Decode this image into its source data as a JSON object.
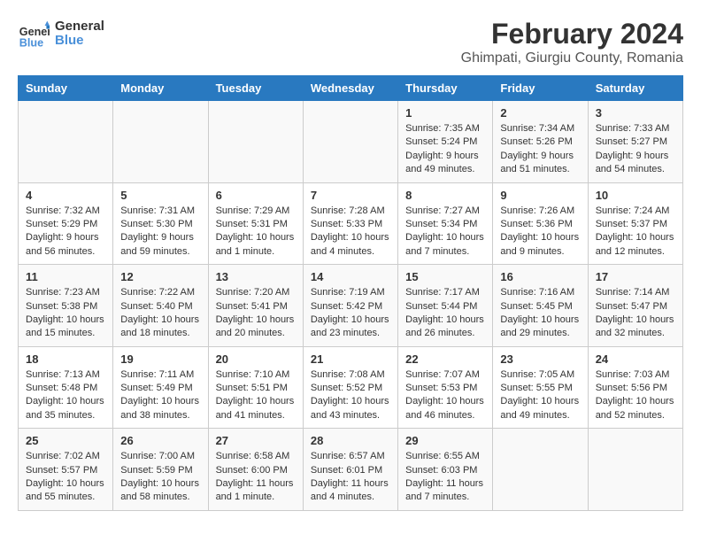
{
  "logo": {
    "line1": "General",
    "line2": "Blue"
  },
  "title": "February 2024",
  "subtitle": "Ghimpati, Giurgiu County, Romania",
  "days_of_week": [
    "Sunday",
    "Monday",
    "Tuesday",
    "Wednesday",
    "Thursday",
    "Friday",
    "Saturday"
  ],
  "weeks": [
    [
      {
        "day": "",
        "info": ""
      },
      {
        "day": "",
        "info": ""
      },
      {
        "day": "",
        "info": ""
      },
      {
        "day": "",
        "info": ""
      },
      {
        "day": "1",
        "info": "Sunrise: 7:35 AM\nSunset: 5:24 PM\nDaylight: 9 hours and 49 minutes."
      },
      {
        "day": "2",
        "info": "Sunrise: 7:34 AM\nSunset: 5:26 PM\nDaylight: 9 hours and 51 minutes."
      },
      {
        "day": "3",
        "info": "Sunrise: 7:33 AM\nSunset: 5:27 PM\nDaylight: 9 hours and 54 minutes."
      }
    ],
    [
      {
        "day": "4",
        "info": "Sunrise: 7:32 AM\nSunset: 5:29 PM\nDaylight: 9 hours and 56 minutes."
      },
      {
        "day": "5",
        "info": "Sunrise: 7:31 AM\nSunset: 5:30 PM\nDaylight: 9 hours and 59 minutes."
      },
      {
        "day": "6",
        "info": "Sunrise: 7:29 AM\nSunset: 5:31 PM\nDaylight: 10 hours and 1 minute."
      },
      {
        "day": "7",
        "info": "Sunrise: 7:28 AM\nSunset: 5:33 PM\nDaylight: 10 hours and 4 minutes."
      },
      {
        "day": "8",
        "info": "Sunrise: 7:27 AM\nSunset: 5:34 PM\nDaylight: 10 hours and 7 minutes."
      },
      {
        "day": "9",
        "info": "Sunrise: 7:26 AM\nSunset: 5:36 PM\nDaylight: 10 hours and 9 minutes."
      },
      {
        "day": "10",
        "info": "Sunrise: 7:24 AM\nSunset: 5:37 PM\nDaylight: 10 hours and 12 minutes."
      }
    ],
    [
      {
        "day": "11",
        "info": "Sunrise: 7:23 AM\nSunset: 5:38 PM\nDaylight: 10 hours and 15 minutes."
      },
      {
        "day": "12",
        "info": "Sunrise: 7:22 AM\nSunset: 5:40 PM\nDaylight: 10 hours and 18 minutes."
      },
      {
        "day": "13",
        "info": "Sunrise: 7:20 AM\nSunset: 5:41 PM\nDaylight: 10 hours and 20 minutes."
      },
      {
        "day": "14",
        "info": "Sunrise: 7:19 AM\nSunset: 5:42 PM\nDaylight: 10 hours and 23 minutes."
      },
      {
        "day": "15",
        "info": "Sunrise: 7:17 AM\nSunset: 5:44 PM\nDaylight: 10 hours and 26 minutes."
      },
      {
        "day": "16",
        "info": "Sunrise: 7:16 AM\nSunset: 5:45 PM\nDaylight: 10 hours and 29 minutes."
      },
      {
        "day": "17",
        "info": "Sunrise: 7:14 AM\nSunset: 5:47 PM\nDaylight: 10 hours and 32 minutes."
      }
    ],
    [
      {
        "day": "18",
        "info": "Sunrise: 7:13 AM\nSunset: 5:48 PM\nDaylight: 10 hours and 35 minutes."
      },
      {
        "day": "19",
        "info": "Sunrise: 7:11 AM\nSunset: 5:49 PM\nDaylight: 10 hours and 38 minutes."
      },
      {
        "day": "20",
        "info": "Sunrise: 7:10 AM\nSunset: 5:51 PM\nDaylight: 10 hours and 41 minutes."
      },
      {
        "day": "21",
        "info": "Sunrise: 7:08 AM\nSunset: 5:52 PM\nDaylight: 10 hours and 43 minutes."
      },
      {
        "day": "22",
        "info": "Sunrise: 7:07 AM\nSunset: 5:53 PM\nDaylight: 10 hours and 46 minutes."
      },
      {
        "day": "23",
        "info": "Sunrise: 7:05 AM\nSunset: 5:55 PM\nDaylight: 10 hours and 49 minutes."
      },
      {
        "day": "24",
        "info": "Sunrise: 7:03 AM\nSunset: 5:56 PM\nDaylight: 10 hours and 52 minutes."
      }
    ],
    [
      {
        "day": "25",
        "info": "Sunrise: 7:02 AM\nSunset: 5:57 PM\nDaylight: 10 hours and 55 minutes."
      },
      {
        "day": "26",
        "info": "Sunrise: 7:00 AM\nSunset: 5:59 PM\nDaylight: 10 hours and 58 minutes."
      },
      {
        "day": "27",
        "info": "Sunrise: 6:58 AM\nSunset: 6:00 PM\nDaylight: 11 hours and 1 minute."
      },
      {
        "day": "28",
        "info": "Sunrise: 6:57 AM\nSunset: 6:01 PM\nDaylight: 11 hours and 4 minutes."
      },
      {
        "day": "29",
        "info": "Sunrise: 6:55 AM\nSunset: 6:03 PM\nDaylight: 11 hours and 7 minutes."
      },
      {
        "day": "",
        "info": ""
      },
      {
        "day": "",
        "info": ""
      }
    ]
  ]
}
